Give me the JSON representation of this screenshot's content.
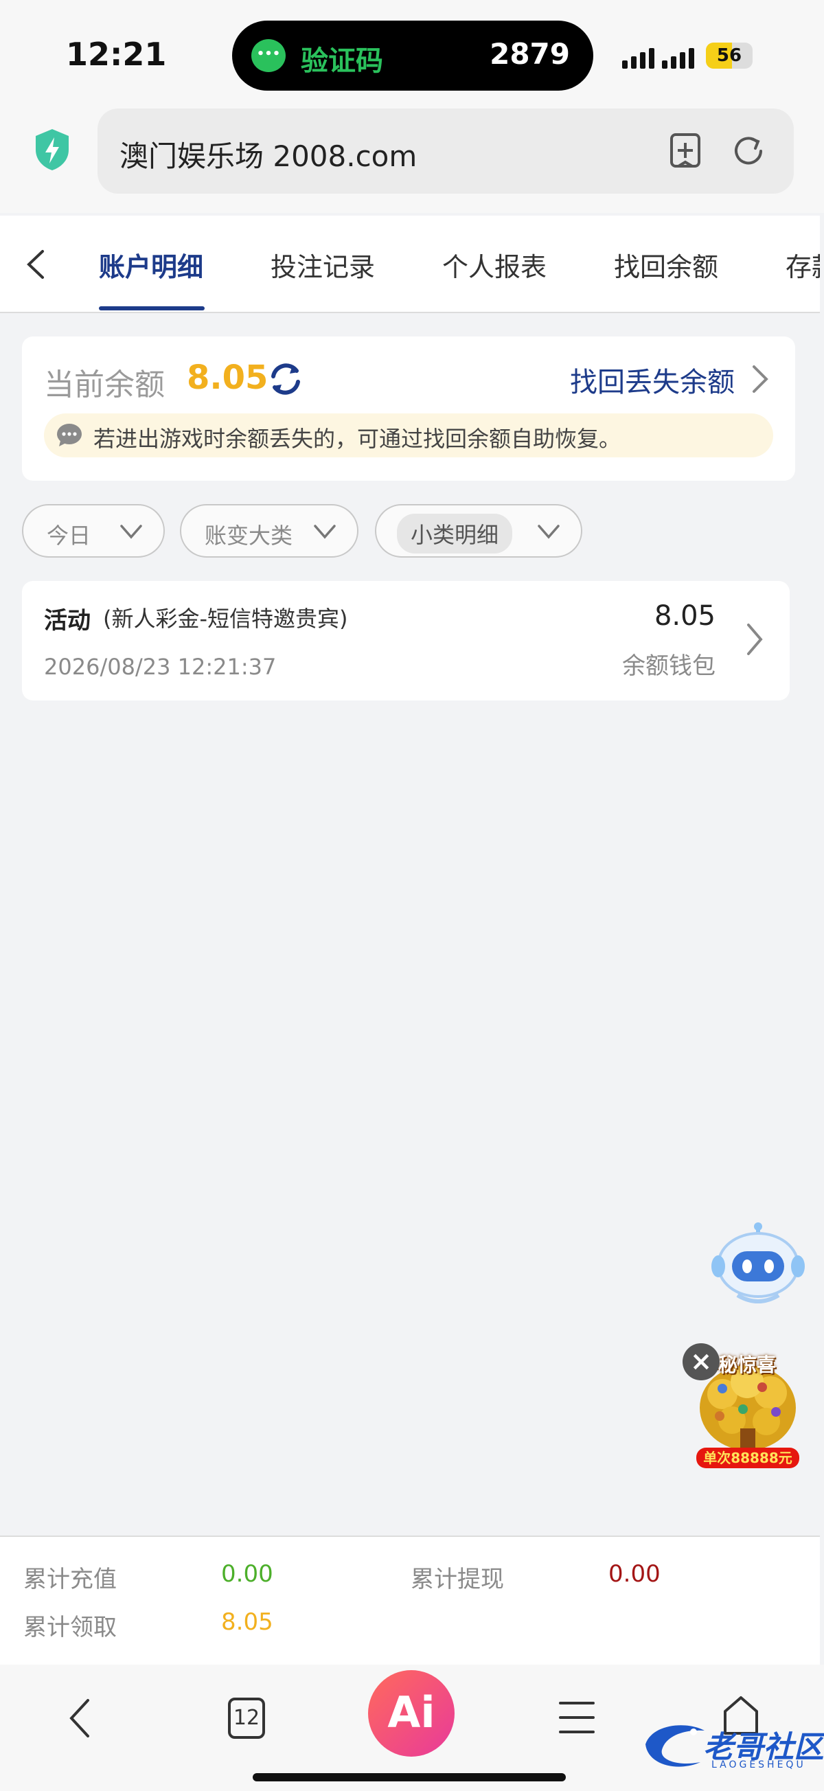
{
  "status_bar": {
    "time": "12:21",
    "notification_app_icon": "wechat-icon",
    "notification_label": "验证码",
    "notification_code": "2879",
    "battery_level": "56",
    "battery_fraction": 0.56
  },
  "browser": {
    "url_text": "澳门娱乐场 2008.com",
    "security_icon": "shield-bolt-icon"
  },
  "tabs": [
    {
      "label": "账户明细",
      "active": true
    },
    {
      "label": "投注记录",
      "active": false
    },
    {
      "label": "个人报表",
      "active": false
    },
    {
      "label": "找回余额",
      "active": false
    },
    {
      "label": "存款",
      "active": false
    }
  ],
  "balance": {
    "label": "当前余额",
    "value": "8.05",
    "recover_link": "找回丢失余额",
    "tip": "若进出游戏时余额丢失的，可通过找回余额自助恢复。"
  },
  "filters": [
    {
      "label": "今日"
    },
    {
      "label": "账变大类"
    },
    {
      "label": "小类明细"
    }
  ],
  "records": [
    {
      "title": "活动",
      "subtitle": "(新人彩金-短信特邀贵宾)",
      "datetime": "2026/08/23 12:21:37",
      "amount": "8.05",
      "wallet": "余额钱包"
    }
  ],
  "promo": {
    "title": "神秘惊喜",
    "price": "单次88888元"
  },
  "summary": {
    "recharge_label": "累计充值",
    "recharge_value": "0.00",
    "withdraw_label": "累计提现",
    "withdraw_value": "0.00",
    "claim_label": "累计领取",
    "claim_value": "8.05"
  },
  "bottom_nav": {
    "tabs_count": "12",
    "ai_label": "Ai"
  },
  "watermark": {
    "text": "老哥社区",
    "sub": "LAOGESHEQU"
  },
  "colors": {
    "brand": "#1d3b8a",
    "balance_gold": "#f2b01e",
    "recharge_green": "#4caf2a",
    "withdraw_red": "#a31515"
  }
}
